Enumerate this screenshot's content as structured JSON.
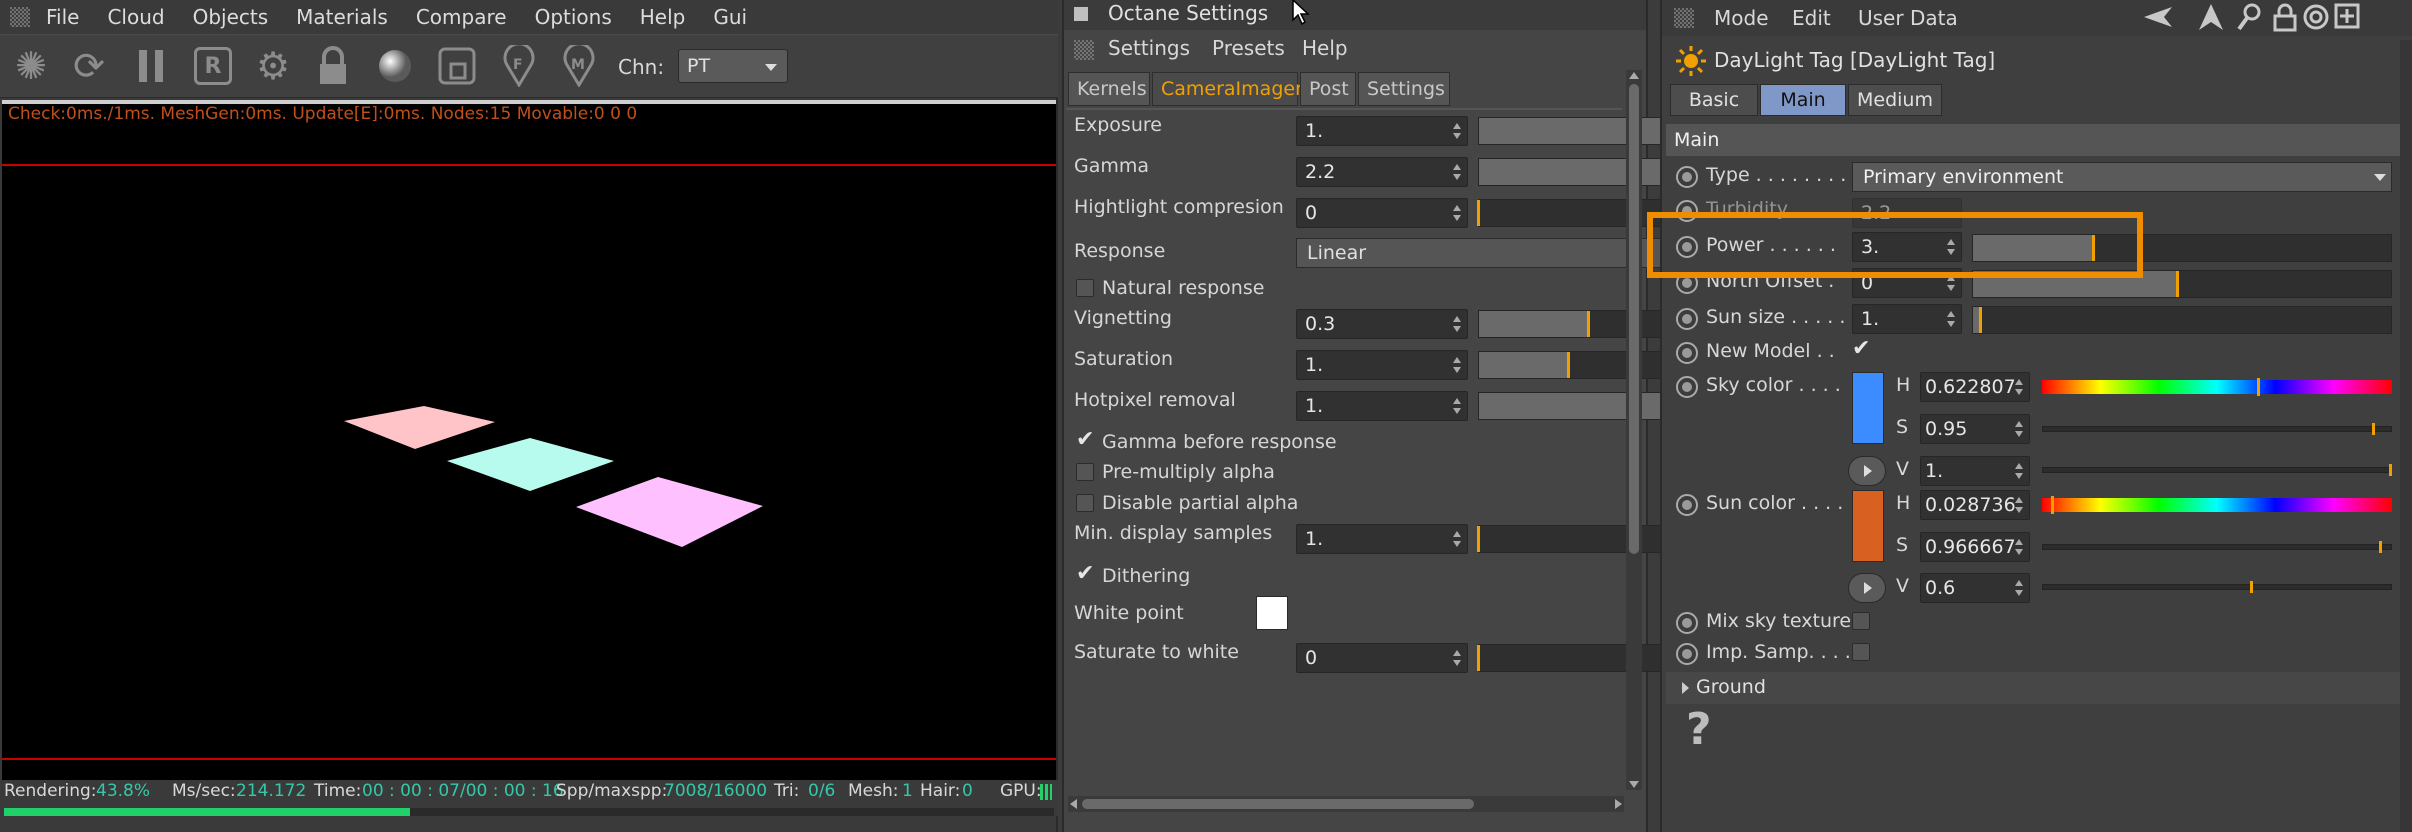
{
  "viewport_panel": {
    "menu": [
      "File",
      "Cloud",
      "Objects",
      "Materials",
      "Compare",
      "Options",
      "Help",
      "Gui"
    ],
    "toolbar": {
      "icon_r_label": "R",
      "chn_label": "Chn:",
      "chn_value": "PT"
    },
    "stats_line": "Check:0ms./1ms. MeshGen:0ms. Update[E]:0ms. Nodes:15 Movable:0  0 0",
    "status": {
      "rendering_label": "Rendering:",
      "rendering_value": "43.8%",
      "ms_label": "Ms/sec:",
      "ms_value": "214.172",
      "time_label": "Time:",
      "time_value": "00 : 00 : 07/00 : 00 : 16",
      "spp_label": "Spp/maxspp:",
      "spp_value": "7008/16000",
      "tri_label": "Tri:",
      "tri_value": "0/6",
      "mesh_label": "Mesh:",
      "mesh_value": "1",
      "hair_label": "Hair:",
      "hair_value": "0",
      "gpu_label": "GPU:"
    },
    "progress": 0.387,
    "colors": {
      "square1": "#ffc4c8",
      "square2": "#b6fbee",
      "square3": "#ffc0ff"
    }
  },
  "octane_panel": {
    "title": "Octane Settings",
    "menu": [
      "Settings",
      "Presets",
      "Help"
    ],
    "tabs": [
      "Kernels",
      "CameraImager",
      "Post",
      "Settings"
    ],
    "active_tab": "CameraImager",
    "rows": {
      "exposure": {
        "label": "Exposure",
        "value": "1.",
        "level": 0
      },
      "gamma": {
        "label": "Gamma",
        "value": "2.2",
        "level": 1.0
      },
      "highlight": {
        "label": "Hightlight compresion",
        "value": "0",
        "level": 0
      },
      "response": {
        "label": "Response",
        "value": "Linear"
      },
      "natural": {
        "label": "Natural response"
      },
      "vignetting": {
        "label": "Vignetting",
        "value": "0.3",
        "level": 0.55
      },
      "saturation": {
        "label": "Saturation",
        "value": "1.",
        "level": 0.45
      },
      "hotpixel": {
        "label": "Hotpixel removal",
        "value": "1.",
        "level": 0
      },
      "gamma_before": {
        "label": "Gamma before response",
        "checked": "✔"
      },
      "premultiply": {
        "label": "Pre-multiply alpha"
      },
      "disable_partial": {
        "label": "Disable partial alpha"
      },
      "min_display": {
        "label": "Min. display samples",
        "value": "1.",
        "level": 0
      },
      "dithering": {
        "label": "Dithering",
        "checked": "✔"
      },
      "white_point": {
        "label": "White point"
      },
      "saturate_white": {
        "label": "Saturate to white",
        "value": "0",
        "level": 0
      }
    }
  },
  "attr_panel": {
    "menu": [
      "Mode",
      "Edit",
      "User Data"
    ],
    "tag_title": "DayLight Tag [DayLight Tag]",
    "mode_tabs": [
      "Basic",
      "Main",
      "Medium"
    ],
    "active_mode_tab": "Main",
    "section_main": "Main",
    "type": {
      "label": "Type . . . . . . . .",
      "value": "Primary environment"
    },
    "turbidity": {
      "label": "Turbidity",
      "value": "2.2"
    },
    "power": {
      "label": "Power . . . . . .",
      "value": "3.",
      "level": 0.29
    },
    "north_offset": {
      "label": "North Offset .",
      "value": "0",
      "level": 0.49
    },
    "sun_size": {
      "label": "Sun size . . . . .",
      "value": "1.",
      "level": 0.02
    },
    "new_model": {
      "label": "New Model . .",
      "checked": "✔"
    },
    "sky_color": {
      "label": "Sky color . . . .",
      "swatch": "#3c8cff",
      "h_label": "H",
      "h_value": "0.622807",
      "h_level": 0.62,
      "s_label": "S",
      "s_value": "0.95",
      "s_level": 0.95,
      "v_label": "V",
      "v_value": "1.",
      "v_level": 1.0
    },
    "sun_color": {
      "label": "Sun color . . . .",
      "swatch": "#d86020",
      "h_label": "H",
      "h_value": "0.028736",
      "h_level": 0.03,
      "s_label": "S",
      "s_value": "0.966667",
      "s_level": 0.97,
      "v_label": "V",
      "v_value": "0.6",
      "v_level": 0.6
    },
    "mix_sky": {
      "label": "Mix sky texture"
    },
    "imp_samp": {
      "label": "Imp. Samp. . . ."
    },
    "ground": {
      "label": "Ground"
    },
    "help_glyph": "?",
    "highlight_color": "#f08c00"
  }
}
